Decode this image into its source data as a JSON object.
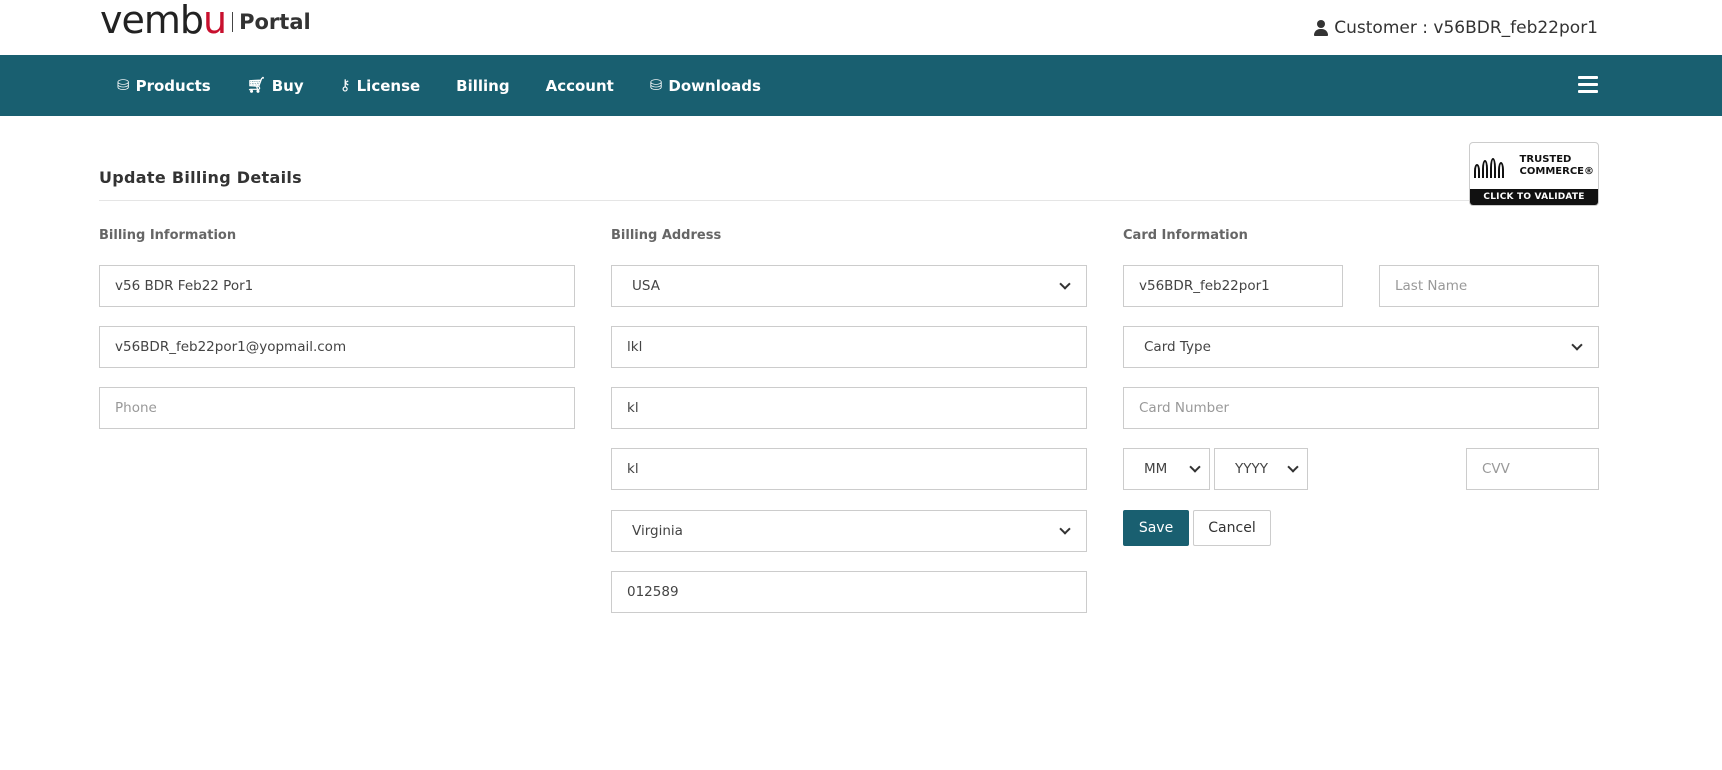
{
  "brand": {
    "logo_prefix": "vemb",
    "logo_accent": "u",
    "portal_label": "Portal"
  },
  "header": {
    "customer_text": "Customer : v56BDR_feb22por1"
  },
  "nav": {
    "items": [
      {
        "label": "Products",
        "icon": "cubes-icon"
      },
      {
        "label": "Buy",
        "icon": "cart-icon"
      },
      {
        "label": "License",
        "icon": "key-icon"
      },
      {
        "label": "Billing",
        "icon": ""
      },
      {
        "label": "Account",
        "icon": ""
      },
      {
        "label": "Downloads",
        "icon": "cubes-icon"
      }
    ],
    "bg_color": "#195f70"
  },
  "page": {
    "title": "Update Billing Details",
    "badge": {
      "line1": "TRUSTED",
      "line2": "COMMERCE®",
      "cta": "CLICK TO VALIDATE"
    }
  },
  "billing_info": {
    "label": "Billing Information",
    "name_value": "v56 BDR Feb22 Por1",
    "email_value": "v56BDR_feb22por1@yopmail.com",
    "phone_placeholder": "Phone"
  },
  "billing_address": {
    "label": "Billing Address",
    "country_selected": "USA",
    "address1_value": "lkl",
    "address2_value": "kl",
    "city_value": "kl",
    "state_selected": "Virginia",
    "zip_value": "012589"
  },
  "card_info": {
    "label": "Card Information",
    "first_name_value": "v56BDR_feb22por1",
    "last_name_placeholder": "Last Name",
    "card_type_selected": "Card Type",
    "card_number_placeholder": "Card Number",
    "month_selected": "MM",
    "year_selected": "YYYY",
    "cvv_placeholder": "CVV",
    "save_label": "Save",
    "cancel_label": "Cancel"
  }
}
